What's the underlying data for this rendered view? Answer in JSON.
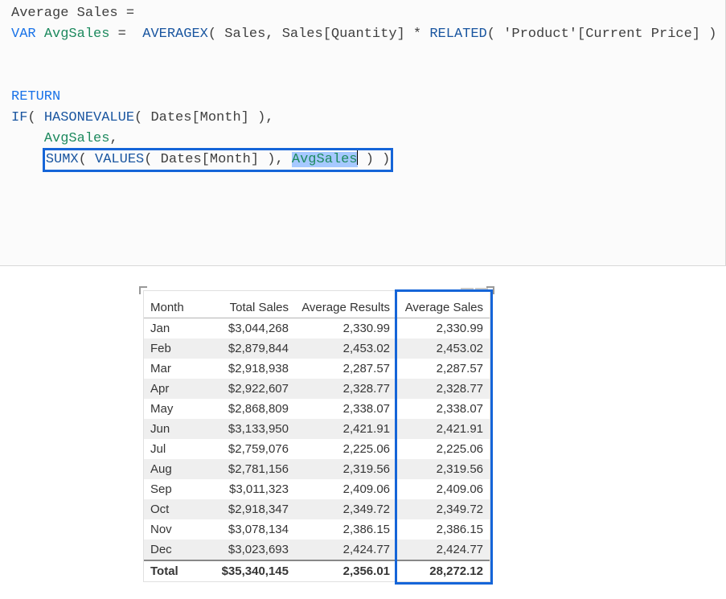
{
  "formula": {
    "measure_name": "Average Sales",
    "var_kw": "VAR",
    "var_name": "AvgSales",
    "averagex_fn": "AVERAGEX",
    "sales_tbl": "Sales",
    "sales_qty": "Sales[Quantity]",
    "related_fn": "RELATED",
    "product_price": "'Product'[Current Price]",
    "return_kw": "RETURN",
    "if_fn": "IF",
    "hasonevalue_fn": "HASONEVALUE",
    "dates_month": "Dates[Month]",
    "avg_var": "AvgSales",
    "sumx_fn": "SUMX",
    "values_fn": "VALUES",
    "avg_var2": "AvgSales"
  },
  "table": {
    "headers": {
      "month": "Month",
      "total_sales": "Total Sales",
      "avg_results": "Average Results",
      "avg_sales": "Average Sales"
    },
    "rows": [
      {
        "m": "Jan",
        "ts": "$3,044,268",
        "ar": "2,330.99",
        "as": "2,330.99"
      },
      {
        "m": "Feb",
        "ts": "$2,879,844",
        "ar": "2,453.02",
        "as": "2,453.02"
      },
      {
        "m": "Mar",
        "ts": "$2,918,938",
        "ar": "2,287.57",
        "as": "2,287.57"
      },
      {
        "m": "Apr",
        "ts": "$2,922,607",
        "ar": "2,328.77",
        "as": "2,328.77"
      },
      {
        "m": "May",
        "ts": "$2,868,809",
        "ar": "2,338.07",
        "as": "2,338.07"
      },
      {
        "m": "Jun",
        "ts": "$3,133,950",
        "ar": "2,421.91",
        "as": "2,421.91"
      },
      {
        "m": "Jul",
        "ts": "$2,759,076",
        "ar": "2,225.06",
        "as": "2,225.06"
      },
      {
        "m": "Aug",
        "ts": "$2,781,156",
        "ar": "2,319.56",
        "as": "2,319.56"
      },
      {
        "m": "Sep",
        "ts": "$3,011,323",
        "ar": "2,409.06",
        "as": "2,409.06"
      },
      {
        "m": "Oct",
        "ts": "$2,918,347",
        "ar": "2,349.72",
        "as": "2,349.72"
      },
      {
        "m": "Nov",
        "ts": "$3,078,134",
        "ar": "2,386.15",
        "as": "2,386.15"
      },
      {
        "m": "Dec",
        "ts": "$3,023,693",
        "ar": "2,424.77",
        "as": "2,424.77"
      }
    ],
    "total": {
      "m": "Total",
      "ts": "$35,340,145",
      "ar": "2,356.01",
      "as": "28,272.12"
    }
  },
  "icons": {
    "grip": "――"
  }
}
